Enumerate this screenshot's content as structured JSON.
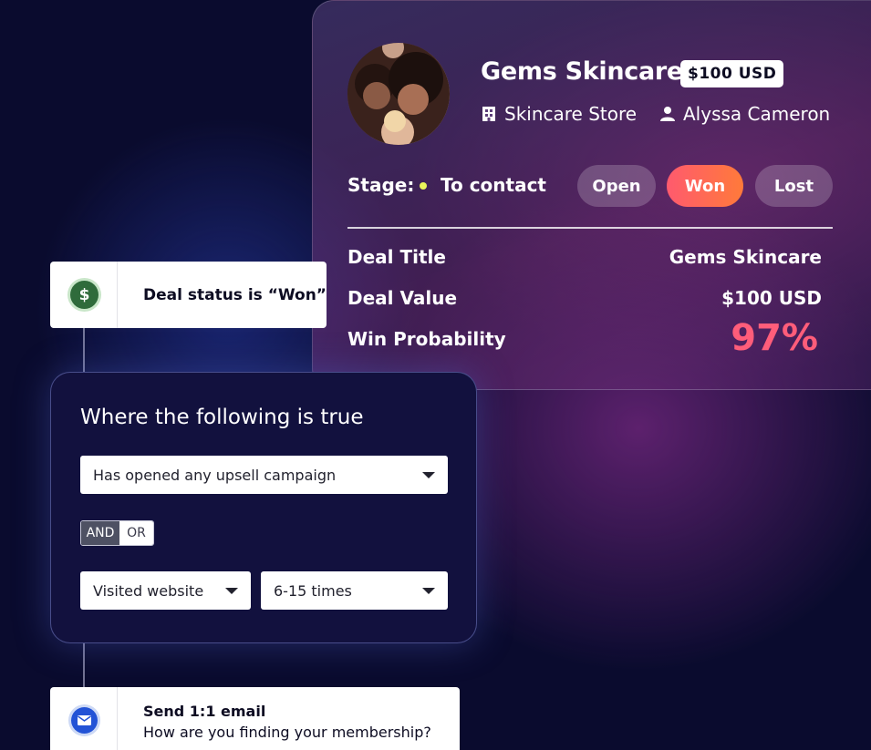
{
  "deal": {
    "company_name": "Gems Skincare",
    "price_badge": "$100 USD",
    "store_type": "Skincare Store",
    "owner": "Alyssa Cameron",
    "stage_label": "Stage:",
    "stage_value": "To contact",
    "status_buttons": {
      "open": "Open",
      "won": "Won",
      "lost": "Lost"
    },
    "rows": [
      {
        "label": "Deal Title",
        "value": "Gems Skincare"
      },
      {
        "label": "Deal Value",
        "value": "$100 USD"
      },
      {
        "label": "Win Probability",
        "value": "97%"
      }
    ],
    "won_gradient": [
      "#ff5a6e",
      "#ff7a3a"
    ]
  },
  "trigger": {
    "icon": "dollar-icon",
    "icon_glyph": "$",
    "text": "Deal status is “Won”"
  },
  "condition": {
    "title": "Where the following is true",
    "select1": "Has opened any upsell campaign",
    "toggle": {
      "and": "AND",
      "or": "OR"
    },
    "select2": "Visited website",
    "select3": "6-15 times"
  },
  "action": {
    "icon": "mail-icon",
    "title": "Send 1:1 email",
    "subtitle": "How are you finding your membership?"
  }
}
